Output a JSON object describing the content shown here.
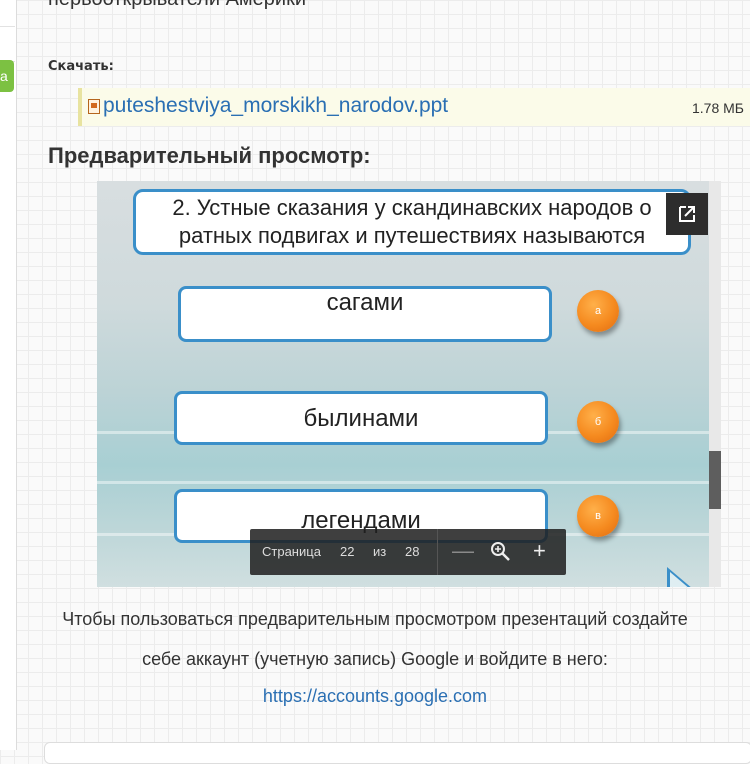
{
  "page": {
    "clipped_title": "первооткрыватели Америки"
  },
  "download": {
    "label": "Скачать:",
    "file_name": "puteshestviya_morskikh_narodov.ppt",
    "file_size": "1.78 МБ"
  },
  "preview": {
    "title": "Предварительный просмотр:"
  },
  "slide": {
    "question_line1": "2. Устные сказания у скандинавских народов о",
    "question_line2": "ратных подвигах и путешествиях называются",
    "answers": [
      {
        "text": "сагами",
        "marker": "а"
      },
      {
        "text": "былинами",
        "marker": "б"
      },
      {
        "text": "легендами",
        "marker": "в"
      }
    ]
  },
  "viewer_toolbar": {
    "page_label": "Страница",
    "current_page": "22",
    "of_label": "из",
    "total_pages": "28",
    "zoom_out": "—",
    "zoom_in": "+"
  },
  "icons": {
    "file": "ppt-file-icon",
    "open": "open-external-icon",
    "magnifier": "zoom-icon",
    "next": "next-slide-arrow-icon"
  },
  "notice": {
    "line1": "Чтобы пользоваться предварительным просмотром презентаций создайте",
    "line2": "себе аккаунт (учетную запись) Google и войдите в него:",
    "link": "https://accounts.google.com"
  },
  "sidebar": {
    "badge": "a"
  }
}
